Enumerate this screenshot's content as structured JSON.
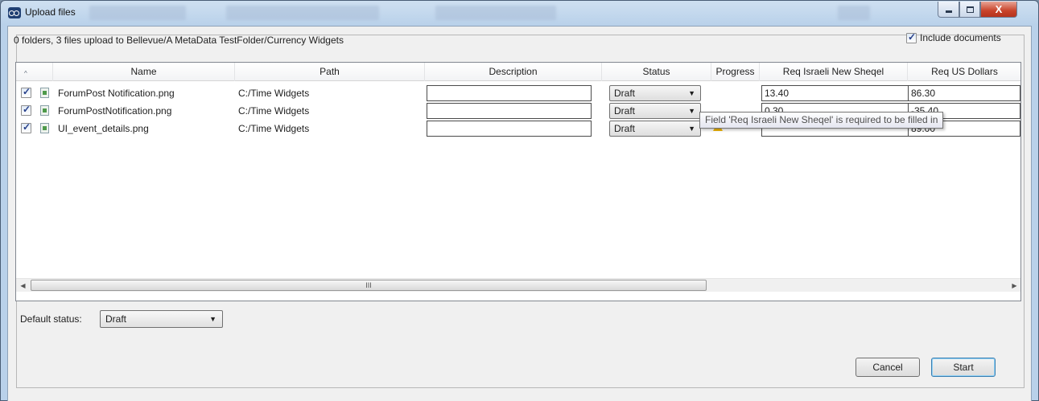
{
  "window": {
    "title": "Upload files",
    "close_glyph": "X"
  },
  "summary": {
    "text": "0 folders, 3 files upload to Bellevue/A MetaData TestFolder/Currency Widgets"
  },
  "include_documents": {
    "label": "Include documents",
    "checked": true
  },
  "grid": {
    "sort_indicator": "^",
    "columns": {
      "name": "Name",
      "path": "Path",
      "description": "Description",
      "status": "Status",
      "progress": "Progress",
      "req_ils": "Req Israeli New Sheqel",
      "req_usd": "Req US Dollars"
    },
    "rows": [
      {
        "checked": true,
        "icon": "image-file-icon",
        "name": "ForumPost  Notification.png",
        "path": "C:/Time Widgets",
        "description": "",
        "status": "Draft",
        "req_ils": "13.40",
        "req_usd": "86.30"
      },
      {
        "checked": true,
        "icon": "image-file-icon",
        "name": "ForumPostNotification.png",
        "path": "C:/Time Widgets",
        "description": "",
        "status": "Draft",
        "req_ils": "0.30",
        "req_usd": "-35.40"
      },
      {
        "checked": true,
        "icon": "image-file-icon",
        "name": "UI_event_details.png",
        "path": "C:/Time Widgets",
        "description": "",
        "status": "Draft",
        "warning": "warning-icon",
        "req_ils": "",
        "req_usd": "89.00"
      }
    ],
    "scrollbar_grip": "III"
  },
  "tooltip": {
    "text": "Field 'Req Israeli New Sheqel' is required to be filled in"
  },
  "default_status": {
    "label": "Default status:",
    "value": "Draft"
  },
  "buttons": {
    "cancel": "Cancel",
    "start": "Start"
  },
  "colors": {
    "window_frame": "#b9d1ea",
    "client_bg": "#f0f0f0",
    "warning": "#f0b400",
    "close_button": "#c8432a"
  }
}
